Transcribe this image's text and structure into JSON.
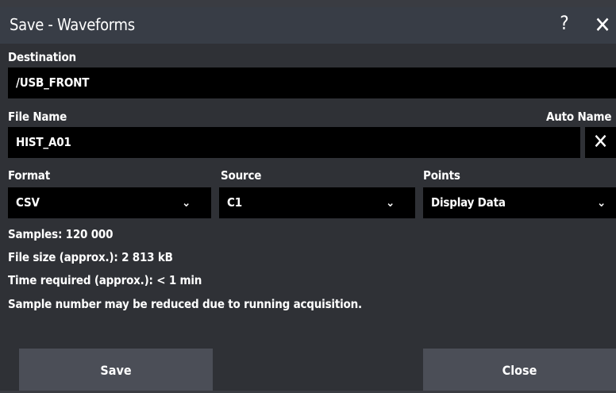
{
  "dialog": {
    "title": "Save - Waveforms",
    "help_glyph": "?",
    "close_glyph": "✕"
  },
  "destination": {
    "label": "Destination",
    "value": "/USB_FRONT"
  },
  "file_name": {
    "label": "File Name",
    "value": "HIST_A01",
    "auto_name_label": "Auto Name",
    "clear_glyph": "✕"
  },
  "format": {
    "label": "Format",
    "value": "CSV"
  },
  "source": {
    "label": "Source",
    "value": "C1"
  },
  "points": {
    "label": "Points",
    "value": "Display Data"
  },
  "info": {
    "samples": "Samples: 120 000",
    "file_size": "File size (approx.): 2 813 kB",
    "time_required": "Time required (approx.): < 1 min",
    "note": "Sample number may be reduced due to running acquisition."
  },
  "buttons": {
    "save": "Save",
    "close": "Close"
  },
  "icons": {
    "chevron": "chevron-down-icon",
    "help": "help-icon",
    "close": "close-icon"
  },
  "colors": {
    "title_bar": "#383d46",
    "panel": "#2f3136",
    "field": "#000000",
    "button": "#4b4e57"
  }
}
